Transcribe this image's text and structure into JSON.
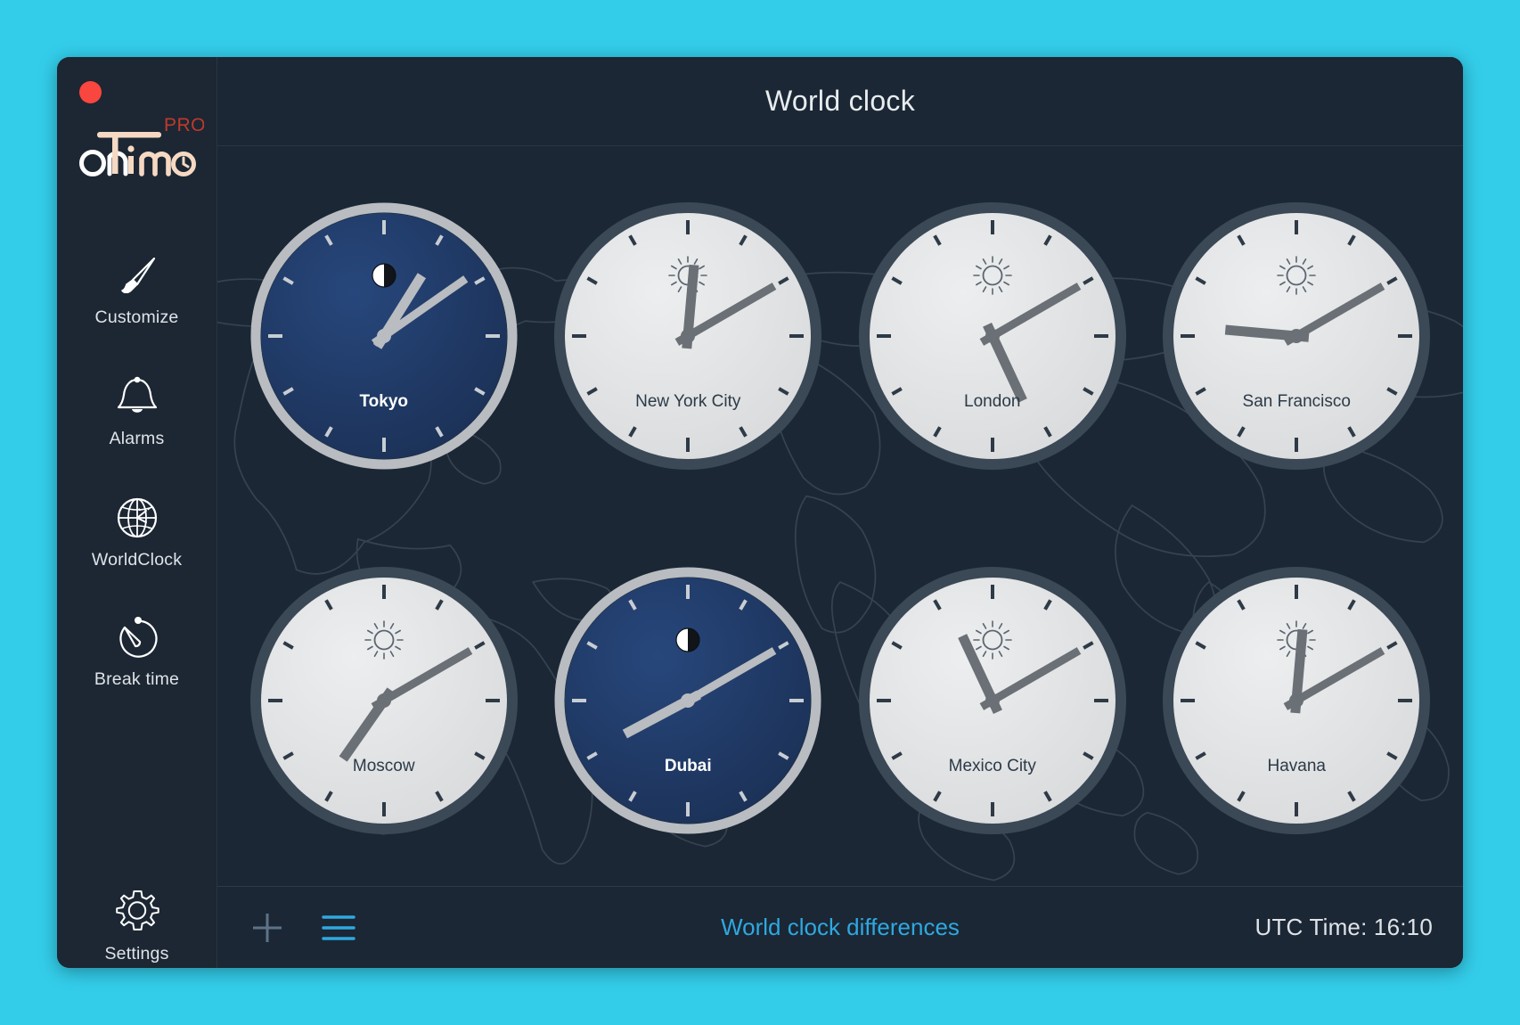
{
  "window": {
    "close_button": "close",
    "logo_main": "onTime",
    "logo_badge": "PRO"
  },
  "sidebar": {
    "items": [
      {
        "id": "customize",
        "label": "Customize",
        "icon": "paintbrush-icon"
      },
      {
        "id": "alarms",
        "label": "Alarms",
        "icon": "bell-icon"
      },
      {
        "id": "worldclock",
        "label": "WorldClock",
        "icon": "globe-clock-icon"
      },
      {
        "id": "break",
        "label": "Break time",
        "icon": "stopwatch-icon"
      },
      {
        "id": "settings",
        "label": "Settings",
        "icon": "gear-icon"
      }
    ]
  },
  "header": {
    "title": "World clock"
  },
  "footer": {
    "add_label": "+",
    "menu_label": "list-menu",
    "differences_link": "World clock differences",
    "utc_time": "UTC Time: 16:10"
  },
  "colors": {
    "app_background": "#33cdea",
    "window": "#1b2735",
    "sidebar": "#1c2733",
    "accent_cyan": "#2fa8e0",
    "night_face": "#1f3a66",
    "day_face": "#e2e4e6",
    "hand": "#6a7075",
    "close_dot": "#f9463f",
    "logo_pro": "#c0392b"
  },
  "clocks": [
    {
      "city": "Tokyo",
      "theme": "night",
      "weather_icon": "moon-icon",
      "time": "01:05",
      "hour_deg": 32,
      "minute_deg": 55
    },
    {
      "city": "New York City",
      "theme": "day",
      "weather_icon": "sun-icon",
      "time": "12:10",
      "hour_deg": 5,
      "minute_deg": 60
    },
    {
      "city": "London",
      "theme": "day",
      "weather_icon": "sun-icon",
      "time": "17:10",
      "hour_deg": 155,
      "minute_deg": 60
    },
    {
      "city": "San Francisco",
      "theme": "day",
      "weather_icon": "sun-icon",
      "time": "09:10",
      "hour_deg": 275,
      "minute_deg": 60
    },
    {
      "city": "Moscow",
      "theme": "day",
      "weather_icon": "sun-icon",
      "time": "19:10",
      "hour_deg": 215,
      "minute_deg": 60
    },
    {
      "city": "Dubai",
      "theme": "night",
      "weather_icon": "moon-icon",
      "time": "20:10",
      "hour_deg": 242,
      "minute_deg": 60
    },
    {
      "city": "Mexico City",
      "theme": "day",
      "weather_icon": "sun-icon",
      "time": "11:10",
      "hour_deg": 335,
      "minute_deg": 60
    },
    {
      "city": "Havana",
      "theme": "day",
      "weather_icon": "sun-icon",
      "time": "12:10",
      "hour_deg": 5,
      "minute_deg": 60
    }
  ]
}
